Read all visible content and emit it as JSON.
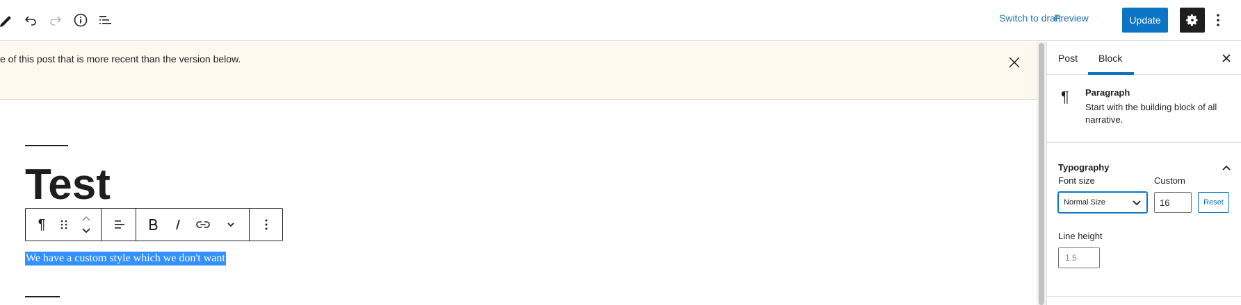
{
  "header": {
    "switch_to_draft": "Switch to draft",
    "preview": "Preview",
    "update": "Update"
  },
  "notice": {
    "text": "e of this post that is more recent than the version below."
  },
  "editor": {
    "title": "Test",
    "paragraph": "We have a custom style which we don't want"
  },
  "sidebar": {
    "tabs": [
      "Post",
      "Block"
    ],
    "active_tab": "Block",
    "block": {
      "name": "Paragraph",
      "description": "Start with the building block of all narrative."
    },
    "typography": {
      "title": "Typography",
      "font_size_label": "Font size",
      "custom_label": "Custom",
      "font_size_value": "Normal Size",
      "custom_value": "16",
      "reset": "Reset",
      "line_height_label": "Line height",
      "line_height_placeholder": "1.5"
    }
  },
  "colors": {
    "accent": "#0b74c4",
    "notice_bg": "#fef8ee",
    "selection": "#3390ff"
  }
}
